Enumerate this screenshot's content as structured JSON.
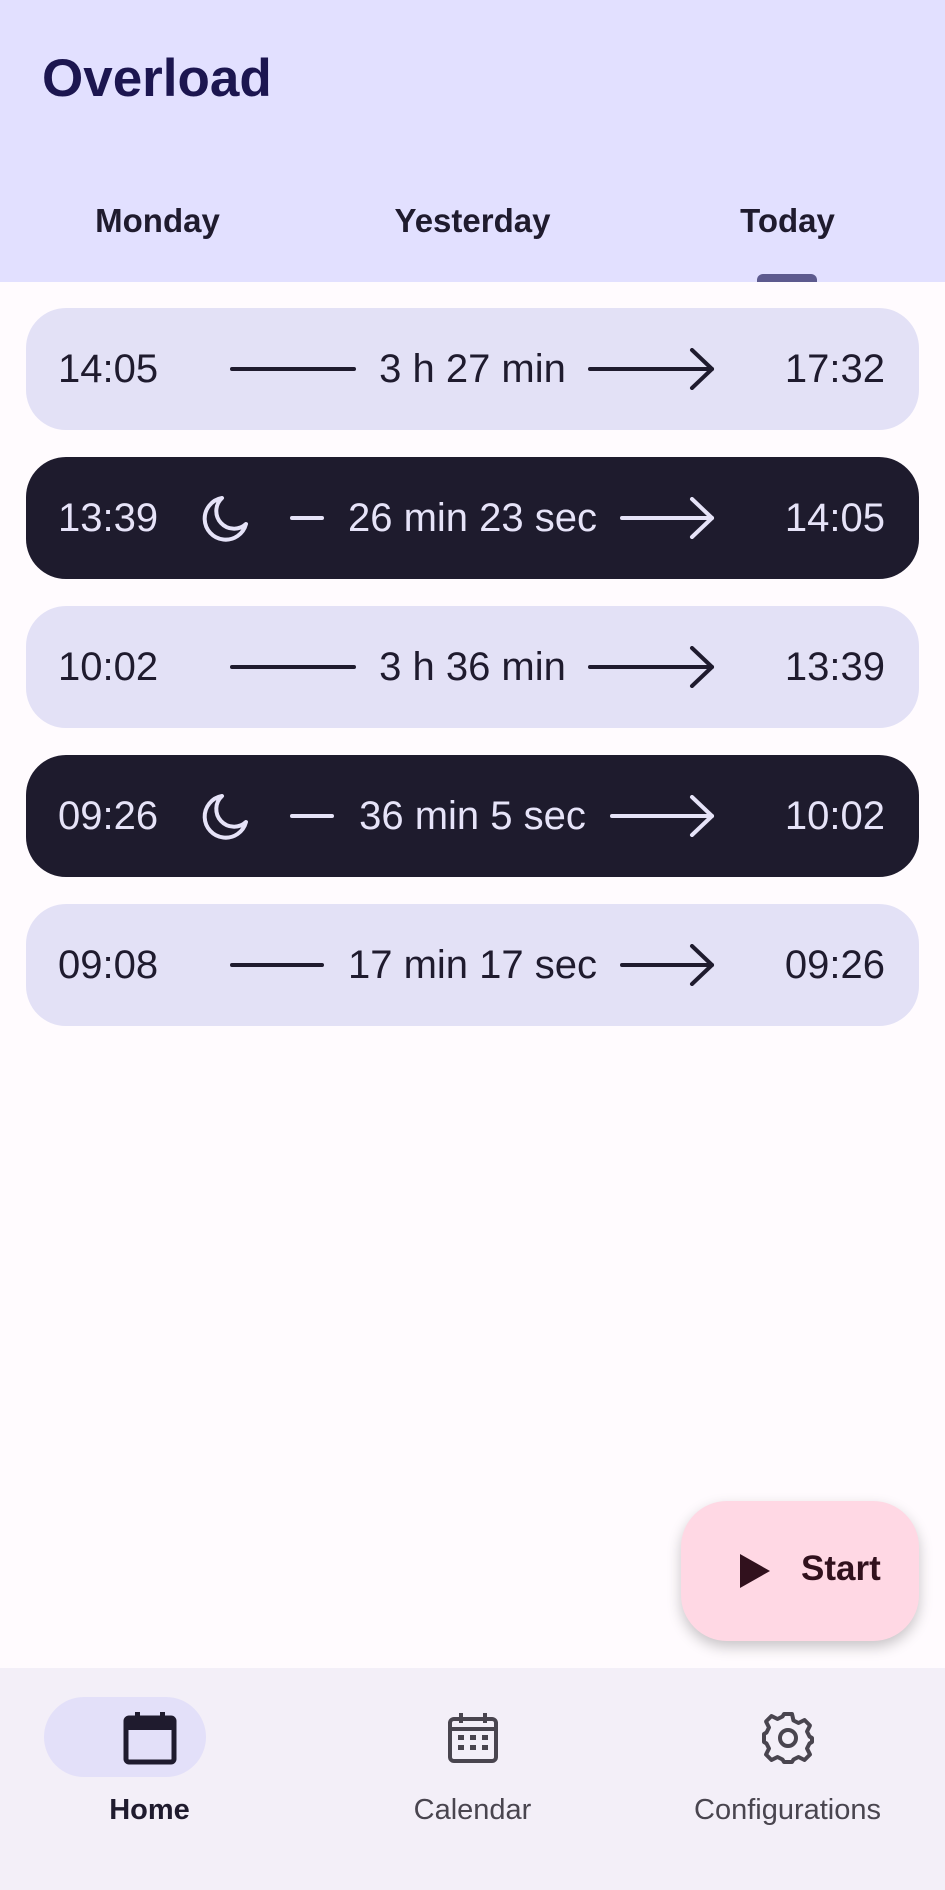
{
  "app": {
    "title": "Overload"
  },
  "tabs": [
    {
      "label": "Monday",
      "selected": false
    },
    {
      "label": "Yesterday",
      "selected": false
    },
    {
      "label": "Today",
      "selected": true
    }
  ],
  "sessions": [
    {
      "type": "work",
      "start": "14:05",
      "duration": "3 h 27 min",
      "end": "17:32"
    },
    {
      "type": "pause",
      "start": "13:39",
      "duration": "26 min 23 sec",
      "end": "14:05",
      "icon": "moon-icon"
    },
    {
      "type": "work",
      "start": "10:02",
      "duration": "3 h 36 min",
      "end": "13:39"
    },
    {
      "type": "pause",
      "start": "09:26",
      "duration": "36 min 5 sec",
      "end": "10:02",
      "icon": "moon-icon"
    },
    {
      "type": "work",
      "start": "09:08",
      "duration": "17 min 17 sec",
      "end": "09:26"
    }
  ],
  "fab": {
    "label": "Start",
    "icon": "play-icon"
  },
  "bottom_nav": [
    {
      "label": "Home",
      "icon": "calendar-day-icon",
      "selected": true
    },
    {
      "label": "Calendar",
      "icon": "calendar-grid-icon",
      "selected": false
    },
    {
      "label": "Configurations",
      "icon": "gear-icon",
      "selected": false
    }
  ],
  "colors": {
    "header_bg": "#e2e0ff",
    "work_row_bg": "#e3e1f6",
    "pause_row_bg": "#1e1b2d",
    "fab_bg": "#ffd8e4",
    "nav_bg": "#f3eff8",
    "tab_indicator": "#5d5a8e"
  }
}
